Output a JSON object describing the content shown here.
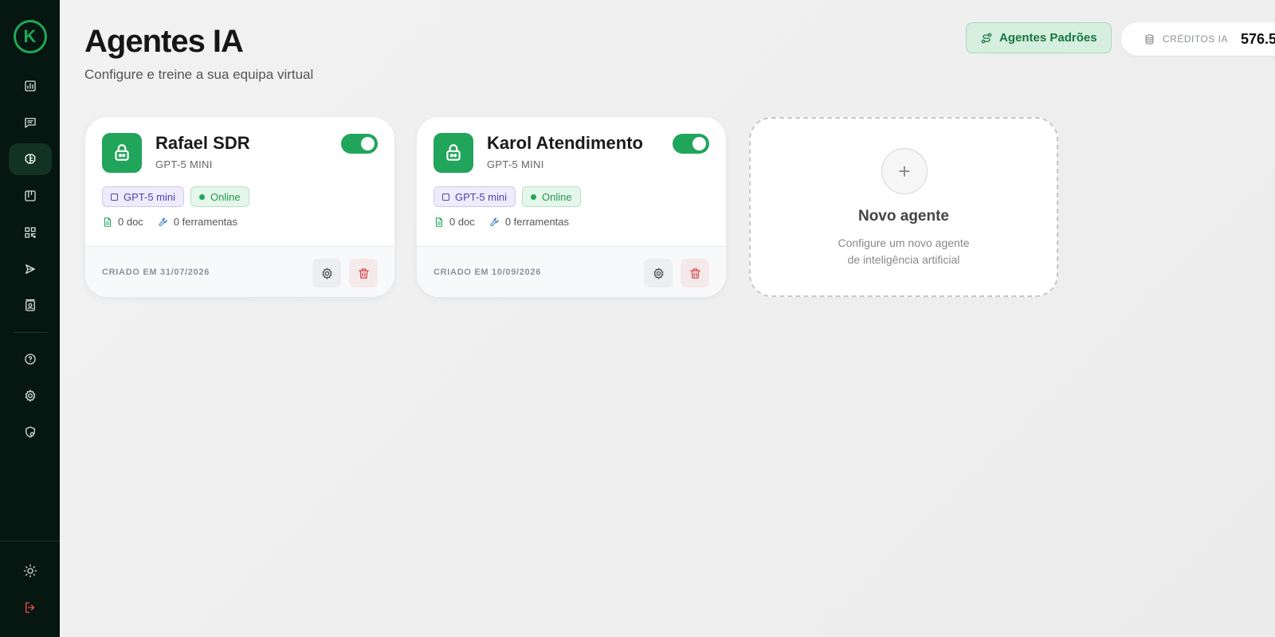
{
  "sidebar": {
    "logo_letter": "K",
    "nav": [
      "dashboard-icon",
      "messages-icon",
      "brain-icon",
      "kanban-icon",
      "qrcode-icon",
      "send-icon",
      "contacts-icon",
      "help-icon",
      "settings-icon",
      "shield-icon"
    ],
    "active": "brain-icon",
    "bottom": [
      "sun-icon",
      "logout-icon"
    ]
  },
  "header": {
    "title": "Agentes IA",
    "subtitle": "Configure e treine a sua equipa virtual",
    "agents_button": "Agentes Padrões",
    "credits_label": "CRÉDITOS IA",
    "credits_value": "576.5"
  },
  "agents": [
    {
      "name": "Rafael SDR",
      "model": "GPT-5 MINI",
      "model_chip": "GPT-5 mini",
      "status": "Online",
      "docs": "0 doc",
      "tools": "0 ferramentas",
      "created": "CRIADO EM 31/07/2026",
      "enabled": true
    },
    {
      "name": "Karol Atendimento",
      "model": "GPT-5 MINI",
      "model_chip": "GPT-5 mini",
      "status": "Online",
      "docs": "0 doc",
      "tools": "0 ferramentas",
      "created": "CRIADO EM 10/09/2026",
      "enabled": true
    }
  ],
  "new_agent": {
    "title": "Novo agente",
    "desc_line1": "Configure um novo agente",
    "desc_line2": "de inteligência artificial"
  },
  "colors": {
    "accent": "#20a55a",
    "sidebar_bg": "#061610",
    "danger": "#d9454a"
  }
}
